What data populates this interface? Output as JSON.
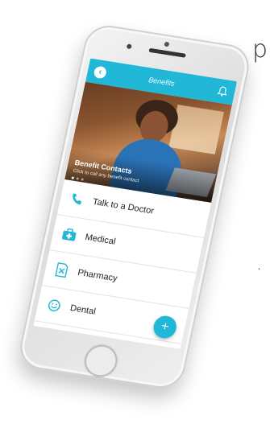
{
  "edge_text": {
    "top": "p",
    "bottom": "."
  },
  "app": {
    "title": "Benefits",
    "back_icon": "chevron-left-icon",
    "bell_icon": "bell-icon",
    "accent_color": "#21b7d6"
  },
  "hero": {
    "title": "Benefit Contacts",
    "subtitle": "Click to call any benefit contact",
    "slide_count": 3,
    "active_slide": 1
  },
  "list": {
    "items": [
      {
        "label": "Talk to a Doctor",
        "icon": "phone-icon"
      },
      {
        "label": "Medical",
        "icon": "medical-kit-icon"
      },
      {
        "label": "Pharmacy",
        "icon": "prescription-icon"
      },
      {
        "label": "Dental",
        "icon": "smile-icon"
      }
    ]
  },
  "fab": {
    "label": "+",
    "icon": "plus-icon"
  }
}
